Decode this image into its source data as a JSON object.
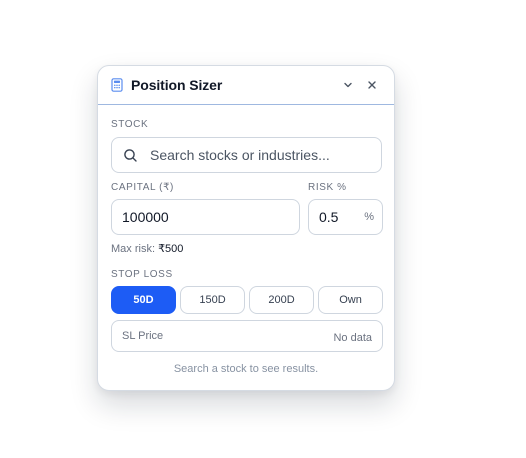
{
  "header": {
    "title": "Position Sizer",
    "icons": {
      "app": "calculator-icon",
      "collapse": "chevron-down-icon",
      "close": "close-icon"
    }
  },
  "stock": {
    "label": "STOCK",
    "placeholder": "Search stocks or industries..."
  },
  "capital": {
    "label": "CAPITAL (₹)",
    "value": "100000"
  },
  "risk": {
    "label": "RISK %",
    "value": "0.5",
    "unit": "%"
  },
  "max_risk": {
    "label": "Max risk:",
    "value": "₹500"
  },
  "stop_loss": {
    "label": "STOP LOSS",
    "options": [
      "50D",
      "150D",
      "200D",
      "Own"
    ],
    "selected": "50D",
    "price_label": "SL Price",
    "price_value": "No data"
  },
  "hint": "Search a stock to see results.",
  "colors": {
    "accent": "#1d5cf5",
    "border": "#cfd6df",
    "header_border": "#9fb8e0"
  }
}
